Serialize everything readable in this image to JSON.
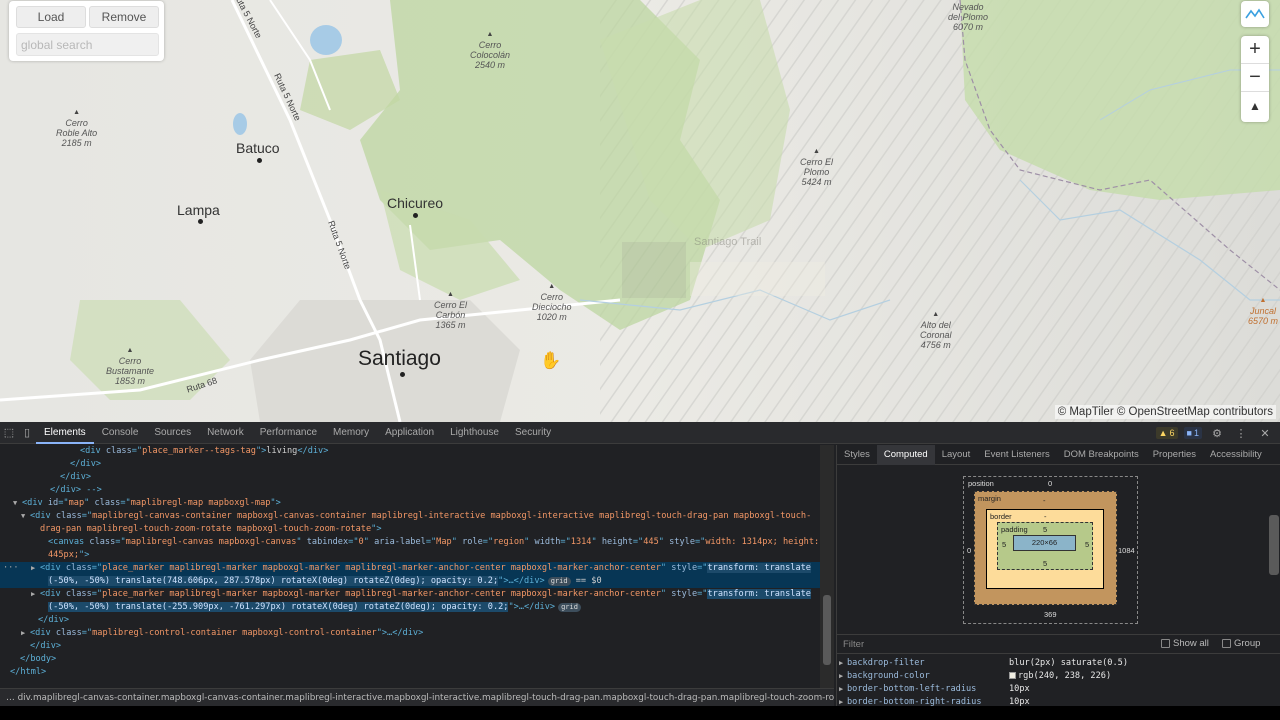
{
  "map": {
    "controls": {
      "load_label": "Load",
      "remove_label": "Remove",
      "search_placeholder": "global search"
    },
    "places": [
      {
        "name": "Santiago"
      },
      {
        "name": "Batuco"
      },
      {
        "name": "Lampa"
      },
      {
        "name": "Chicureo"
      }
    ],
    "peaks": [
      {
        "name": "Cerro",
        "line2": "Colocolán",
        "elev": "2540 m"
      },
      {
        "name": "Cerro",
        "line2": "Roble Alto",
        "elev": "2185 m"
      },
      {
        "name": "Cerro El",
        "line2": "Plomo",
        "elev": "5424 m"
      },
      {
        "name": "Cerro El",
        "line2": "Carbón",
        "elev": "1365 m"
      },
      {
        "name": "Cerro",
        "line2": "Dieciocho",
        "elev": "1020 m"
      },
      {
        "name": "Alto del",
        "line2": "Coronal",
        "elev": "4756 m"
      },
      {
        "name": "Cerro",
        "line2": "Bustamante",
        "elev": "1853 m"
      },
      {
        "name": "Nevado",
        "line2": "del Plomo",
        "elev": "6070 m"
      },
      {
        "name": "Cerro",
        "line2": "Juncal",
        "elev": "6570 m"
      }
    ],
    "roads": [
      "Ruta 5 Norte",
      "Ruta 5 Norte",
      "Ruta 5 Norte",
      "Ruta 68",
      "Ruta 5 Norte"
    ],
    "ghost_label": "Santiago Trail",
    "attribution": "© MapTiler © OpenStreetMap contributors",
    "zoom_in": "+",
    "zoom_out": "−",
    "compass": "▲"
  },
  "devtools": {
    "tabs": [
      "Elements",
      "Console",
      "Sources",
      "Network",
      "Performance",
      "Memory",
      "Application",
      "Lighthouse",
      "Security"
    ],
    "active_tab": "Elements",
    "warnings": "6",
    "messages": "1",
    "dom_lines": [
      {
        "indent": 80,
        "parts": [
          [
            "tag",
            "<div "
          ],
          [
            "attr",
            "class"
          ],
          [
            "tag",
            "=\""
          ],
          [
            "val",
            "place_marker--tags-tag"
          ],
          [
            "tag",
            "\">"
          ],
          [
            "txt",
            "living"
          ],
          [
            "tag",
            "</div>"
          ]
        ]
      },
      {
        "indent": 70,
        "parts": [
          [
            "tag",
            "</div>"
          ]
        ]
      },
      {
        "indent": 60,
        "parts": [
          [
            "tag",
            "</div>"
          ]
        ]
      },
      {
        "indent": 50,
        "parts": [
          [
            "tag",
            "</div> -->"
          ]
        ]
      },
      {
        "indent": 22,
        "arrow": "▼",
        "parts": [
          [
            "tag",
            "<div "
          ],
          [
            "attr",
            "id"
          ],
          [
            "tag",
            "=\""
          ],
          [
            "val",
            "map"
          ],
          [
            "tag",
            "\" "
          ],
          [
            "attr",
            "class"
          ],
          [
            "tag",
            "=\""
          ],
          [
            "val",
            "maplibregl-map mapboxgl-map"
          ],
          [
            "tag",
            "\">"
          ]
        ]
      },
      {
        "indent": 30,
        "arrow": "▼",
        "parts": [
          [
            "tag",
            "<div "
          ],
          [
            "attr",
            "class"
          ],
          [
            "tag",
            "=\""
          ],
          [
            "val",
            "maplibregl-canvas-container mapboxgl-canvas-container maplibregl-interactive mapboxgl-interactive maplibregl-touch-drag-pan mapboxgl-touch-"
          ],
          [
            "tag",
            ""
          ]
        ]
      },
      {
        "indent": 40,
        "parts": [
          [
            "val",
            "drag-pan maplibregl-touch-zoom-rotate mapboxgl-touch-zoom-rotate"
          ],
          [
            "tag",
            "\">"
          ]
        ]
      },
      {
        "indent": 48,
        "parts": [
          [
            "tag",
            "<canvas "
          ],
          [
            "attr",
            "class"
          ],
          [
            "tag",
            "=\""
          ],
          [
            "val",
            "maplibregl-canvas mapboxgl-canvas"
          ],
          [
            "tag",
            "\" "
          ],
          [
            "attr",
            "tabindex"
          ],
          [
            "tag",
            "=\""
          ],
          [
            "val",
            "0"
          ],
          [
            "tag",
            "\" "
          ],
          [
            "attr",
            "aria-label"
          ],
          [
            "tag",
            "=\""
          ],
          [
            "val",
            "Map"
          ],
          [
            "tag",
            "\" "
          ],
          [
            "attr",
            "role"
          ],
          [
            "tag",
            "=\""
          ],
          [
            "val",
            "region"
          ],
          [
            "tag",
            "\" "
          ],
          [
            "attr",
            "width"
          ],
          [
            "tag",
            "=\""
          ],
          [
            "val",
            "1314"
          ],
          [
            "tag",
            "\" "
          ],
          [
            "attr",
            "height"
          ],
          [
            "tag",
            "=\""
          ],
          [
            "val",
            "445"
          ],
          [
            "tag",
            "\" "
          ],
          [
            "attr",
            "style"
          ],
          [
            "tag",
            "=\""
          ],
          [
            "val",
            "width: 1314px; height:"
          ]
        ]
      },
      {
        "indent": 48,
        "parts": [
          [
            "val",
            "445px;"
          ],
          [
            "tag",
            "\">"
          ]
        ]
      },
      {
        "indent": 40,
        "arrow": "▶",
        "sel": true,
        "parts": [
          [
            "tag",
            "<div "
          ],
          [
            "attr",
            "class"
          ],
          [
            "tag",
            "=\""
          ],
          [
            "val",
            "place_marker maplibregl-marker mapboxgl-marker maplibregl-marker-anchor-center mapboxgl-marker-anchor-center"
          ],
          [
            "tag",
            "\" "
          ],
          [
            "attr",
            "style"
          ],
          [
            "tag",
            "=\""
          ],
          [
            "hl",
            "transform: translate"
          ]
        ]
      },
      {
        "indent": 48,
        "sel": true,
        "parts": [
          [
            "hl",
            "(-50%, -50%) translate(748.606px, 287.578px) rotateX(0deg) rotateZ(0deg); opacity: 0.2;"
          ],
          [
            "tag",
            "\">…</div>"
          ],
          [
            "grid",
            "grid"
          ],
          [
            "txt",
            " == $0"
          ]
        ]
      },
      {
        "indent": 40,
        "arrow": "▶",
        "parts": [
          [
            "tag",
            "<div "
          ],
          [
            "attr",
            "class"
          ],
          [
            "tag",
            "=\""
          ],
          [
            "val",
            "place_marker maplibregl-marker mapboxgl-marker maplibregl-marker-anchor-center mapboxgl-marker-anchor-center"
          ],
          [
            "tag",
            "\" "
          ],
          [
            "attr",
            "style"
          ],
          [
            "tag",
            "=\""
          ],
          [
            "hl",
            "transform: translate"
          ]
        ]
      },
      {
        "indent": 48,
        "parts": [
          [
            "hl",
            "(-50%, -50%) translate(-255.909px, -761.297px) rotateX(0deg) rotateZ(0deg); opacity: 0.2;"
          ],
          [
            "tag",
            "\">…</div>"
          ],
          [
            "grid",
            "grid"
          ]
        ]
      },
      {
        "indent": 38,
        "parts": [
          [
            "tag",
            "</div>"
          ]
        ]
      },
      {
        "indent": 30,
        "arrow": "▶",
        "parts": [
          [
            "tag",
            "<div "
          ],
          [
            "attr",
            "class"
          ],
          [
            "tag",
            "=\""
          ],
          [
            "val",
            "maplibregl-control-container mapboxgl-control-container"
          ],
          [
            "tag",
            "\">…</div>"
          ]
        ]
      },
      {
        "indent": 30,
        "parts": [
          [
            "tag",
            "</div>"
          ]
        ]
      },
      {
        "indent": 20,
        "parts": [
          [
            "tag",
            "</body>"
          ]
        ]
      },
      {
        "indent": 10,
        "parts": [
          [
            "tag",
            "</html>"
          ]
        ]
      }
    ],
    "breadcrumb": "div.maplibregl-canvas-container.mapboxgl-canvas-container.maplibregl-interactive.mapboxgl-interactive.maplibregl-touch-drag-pan.mapboxgl-touch-drag-pan.maplibregl-touch-zoom-rotat",
    "side_tabs": [
      "Styles",
      "Computed",
      "Layout",
      "Event Listeners",
      "DOM Breakpoints",
      "Properties",
      "Accessibility"
    ],
    "side_active": "Computed",
    "box_model": {
      "position_label": "position",
      "position_top": "0",
      "position_left": "0",
      "position_right": "1084",
      "position_bottom": "369",
      "margin_label": "margin",
      "margin_value": "-",
      "border_label": "border",
      "border_value": "-",
      "padding_label": "padding",
      "padding_value": "5",
      "content": "220×66"
    },
    "filter_placeholder": "Filter",
    "show_all_label": "Show all",
    "group_label": "Group",
    "computed_props": [
      {
        "name": "backdrop-filter",
        "value": "blur(2px) saturate(0.5)"
      },
      {
        "name": "background-color",
        "value": "rgb(240, 238, 226)",
        "swatch": "#f0eee2"
      },
      {
        "name": "border-bottom-left-radius",
        "value": "10px"
      },
      {
        "name": "border-bottom-right-radius",
        "value": "10px"
      }
    ]
  }
}
